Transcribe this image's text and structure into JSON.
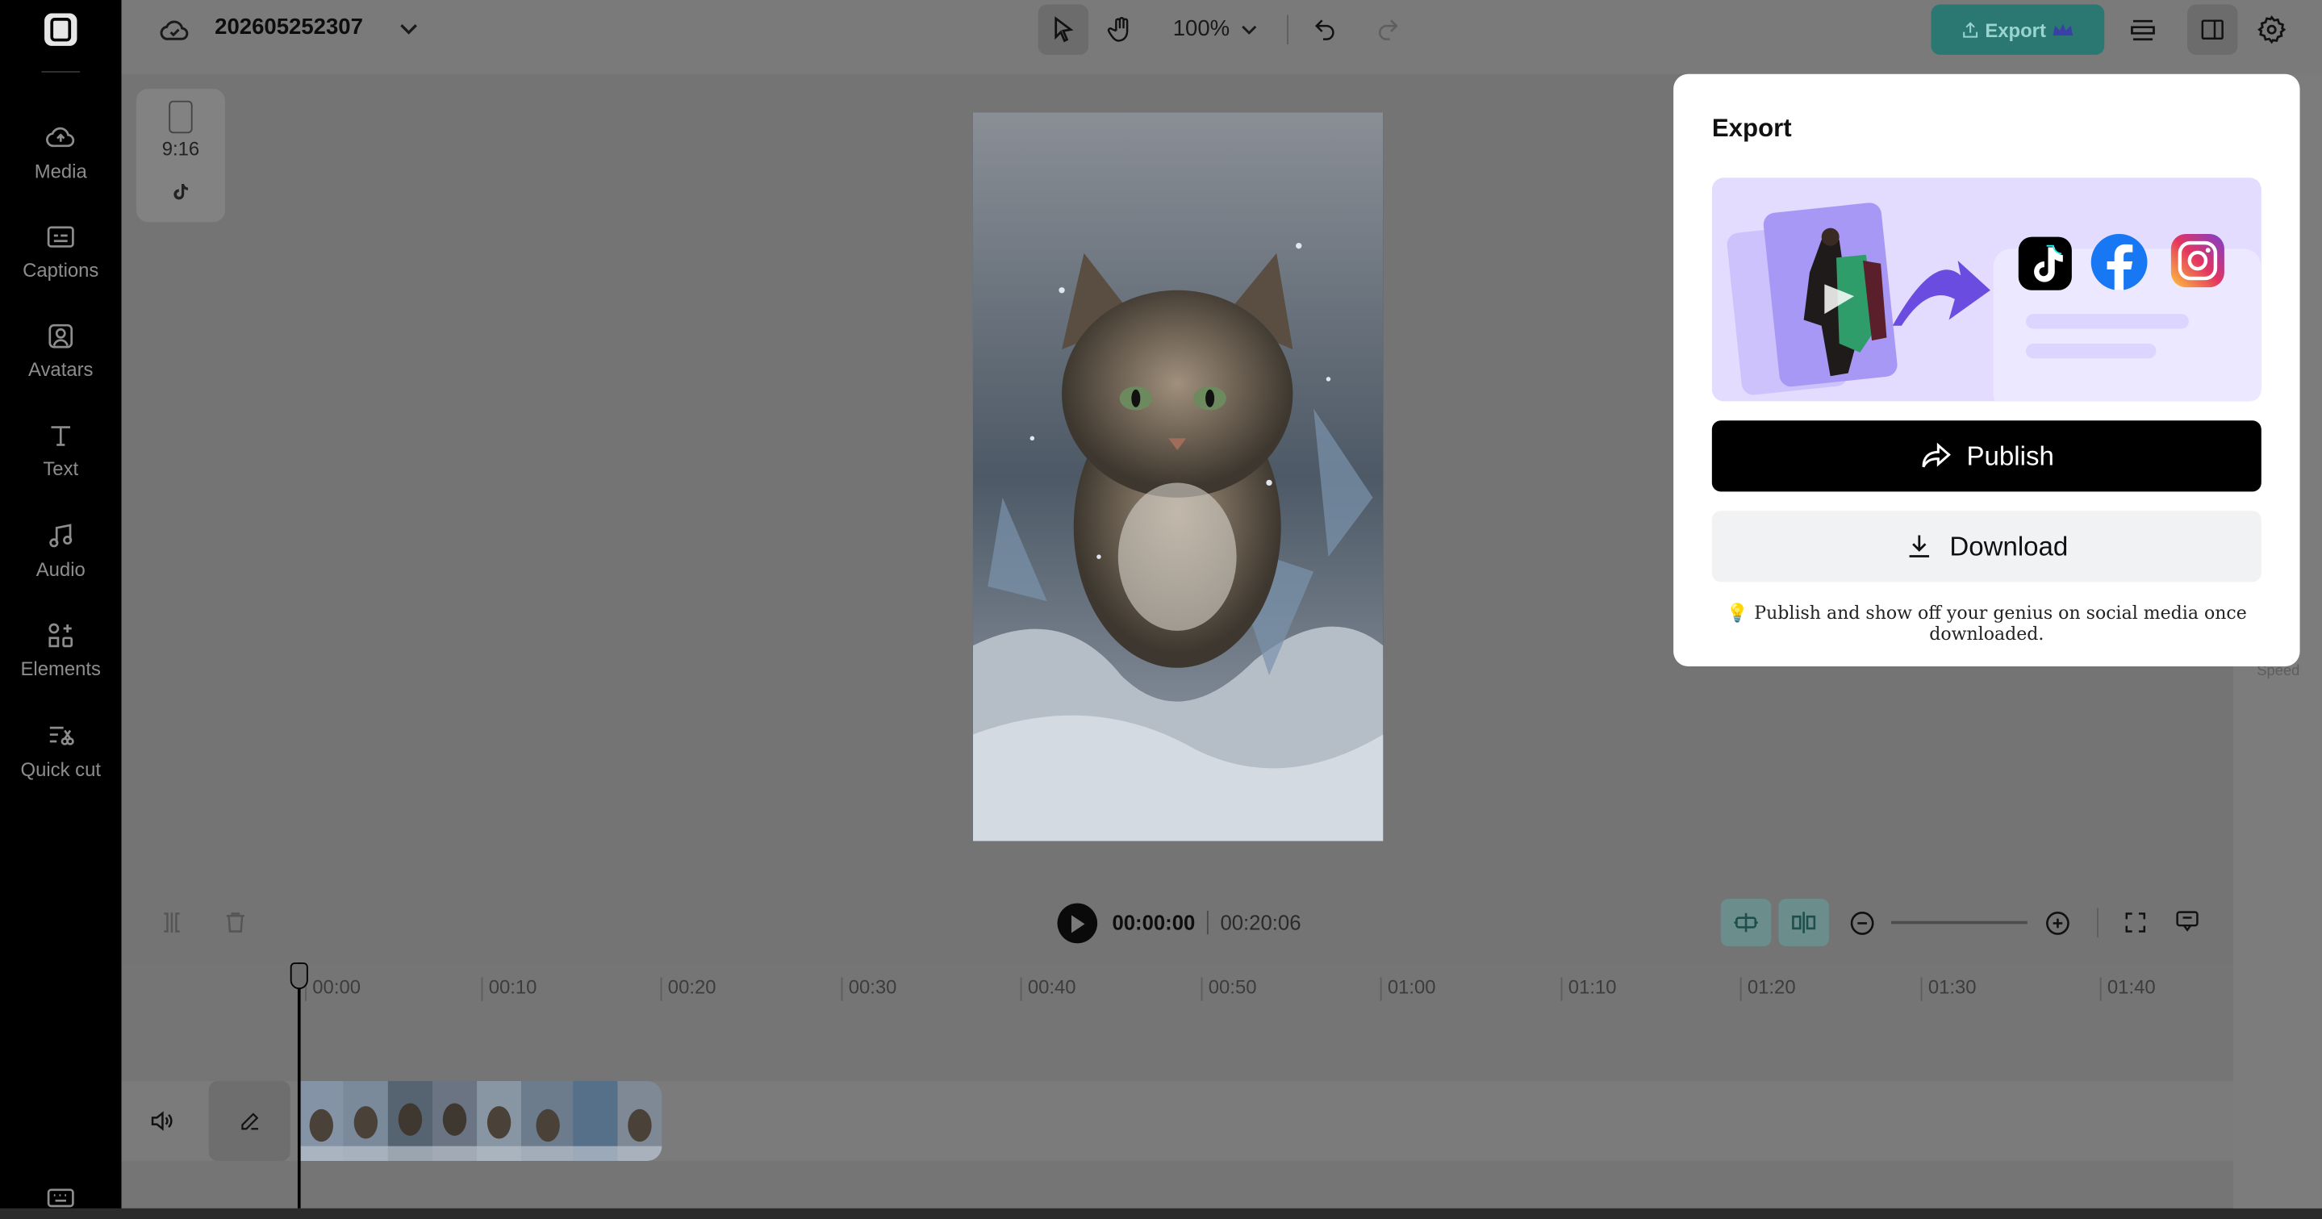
{
  "header": {
    "project_title": "202605252307",
    "zoom": "100%",
    "export_label": "Export"
  },
  "sidebar": {
    "items": [
      {
        "label": "Media",
        "icon": "cloud-upload-icon"
      },
      {
        "label": "Captions",
        "icon": "captions-icon"
      },
      {
        "label": "Avatars",
        "icon": "avatar-icon"
      },
      {
        "label": "Text",
        "icon": "text-icon"
      },
      {
        "label": "Audio",
        "icon": "music-note-icon"
      },
      {
        "label": "Elements",
        "icon": "elements-icon"
      },
      {
        "label": "Quick cut",
        "icon": "quick-cut-icon"
      }
    ]
  },
  "canvas": {
    "aspect_ratio": "9:16",
    "platform_icon": "tiktok-icon"
  },
  "player": {
    "current_time": "00:00:00",
    "total_time": "00:20:06"
  },
  "timeline": {
    "ticks": [
      "00:00",
      "00:10",
      "00:20",
      "00:30",
      "00:40",
      "00:50",
      "01:00",
      "01:10",
      "01:20",
      "01:30",
      "01:40"
    ]
  },
  "right_panel": {
    "speed_label": "Speed"
  },
  "export_popover": {
    "title": "Export",
    "publish_label": "Publish",
    "download_label": "Download",
    "tip": "Publish and show off your genius on social media once downloaded.",
    "social_icons": [
      "tiktok-icon",
      "facebook-icon",
      "instagram-icon"
    ]
  },
  "colors": {
    "export_button": "#2b7873",
    "publish_button": "#000000",
    "banner": "#e3dcff",
    "accent_purple": "#6a4ce0"
  }
}
